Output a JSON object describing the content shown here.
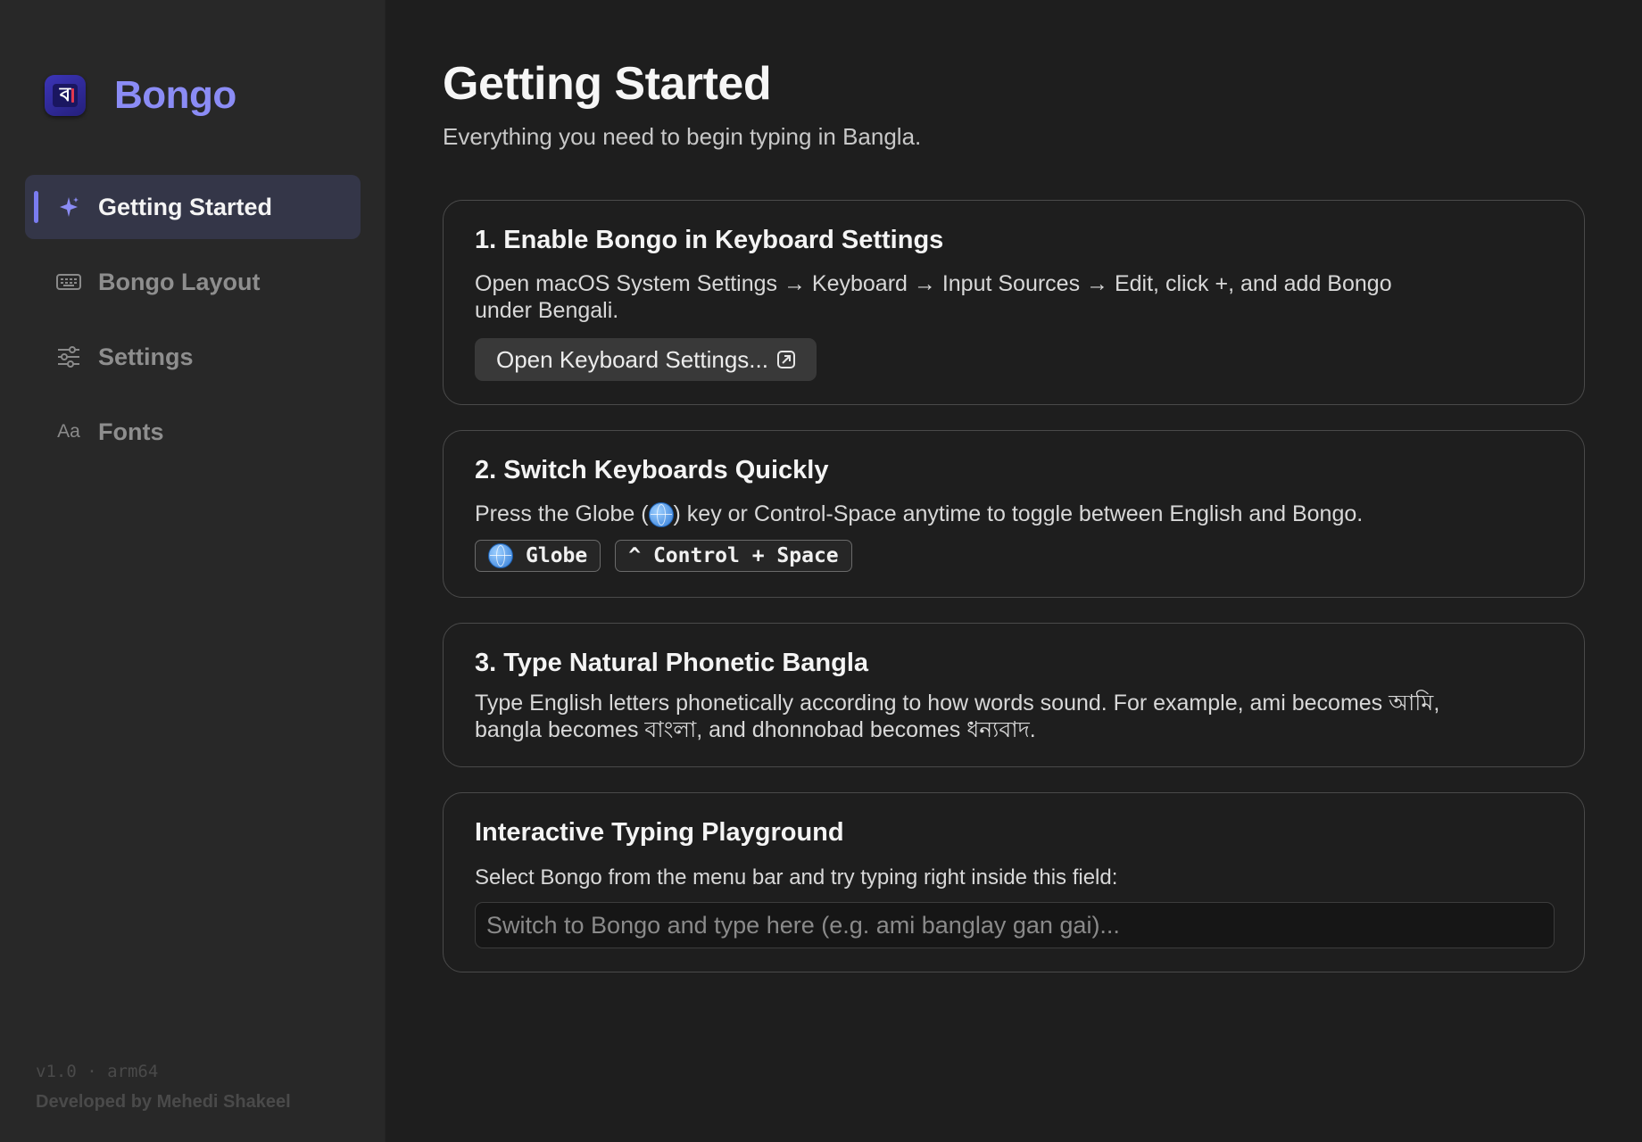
{
  "brand": {
    "name": "Bongo",
    "logo_glyph": "ব"
  },
  "sidebar": {
    "items": [
      {
        "label": "Getting Started",
        "icon": "sparkle-icon",
        "active": true
      },
      {
        "label": "Bongo Layout",
        "icon": "keyboard-icon",
        "active": false
      },
      {
        "label": "Settings",
        "icon": "sliders-icon",
        "active": false
      },
      {
        "label": "Fonts",
        "icon": "font-icon",
        "icon_text": "Aa",
        "active": false
      }
    ],
    "footer": {
      "version": "v1.0 · arm64",
      "developer": "Developed by Mehedi Shakeel"
    }
  },
  "main": {
    "title": "Getting Started",
    "subtitle": "Everything you need to begin typing in Bangla.",
    "step1": {
      "title": "1. Enable Bongo in Keyboard Settings",
      "text": "Open macOS System Settings → Keyboard → Input Sources → Edit, click +, and add Bongo under Bengali.",
      "button_label": "Open Keyboard Settings..."
    },
    "step2": {
      "title": "2. Switch Keyboards Quickly",
      "text_before": "Press the Globe (",
      "text_after": ") key or Control-Space anytime to toggle between English and Bongo.",
      "key_globe": "Globe",
      "key_control": "^ Control + Space"
    },
    "step3": {
      "title": "3. Type Natural Phonetic Bangla",
      "text": "Type English letters phonetically according to how words sound. For example, ami becomes আমি, bangla becomes বাংলা, and dhonnobad becomes ধন্যবাদ."
    },
    "playground": {
      "title": "Interactive Typing Playground",
      "text": "Select Bongo from the menu bar and try typing right inside this field:",
      "value": "",
      "placeholder": "Switch to Bongo and type here (e.g. ami banglay gan gai)..."
    }
  },
  "colors": {
    "accent": "#8b8cf5",
    "sidebar_bg": "#282828",
    "main_bg": "#1e1e1e",
    "active_item_bg": "#343648"
  }
}
